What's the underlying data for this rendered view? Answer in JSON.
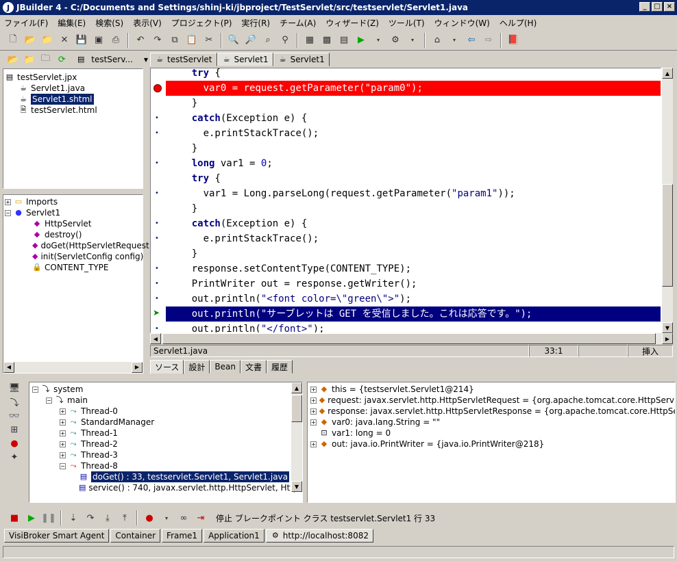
{
  "window": {
    "title": "JBuilder 4 - C:/Documents and Settings/shinj-ki/jbproject/TestServlet/src/testservlet/Servlet1.java",
    "app_icon": "J"
  },
  "menu": [
    "ファイル(F)",
    "編集(E)",
    "検索(S)",
    "表示(V)",
    "プロジェクト(P)",
    "実行(R)",
    "チーム(A)",
    "ウィザード(Z)",
    "ツール(T)",
    "ウィンドウ(W)",
    "ヘルプ(H)"
  ],
  "project_bar": {
    "combo": "testServ...",
    "tabs": [
      "testServlet",
      "Servlet1",
      "Servlet1"
    ]
  },
  "project_tree": {
    "root": "testServlet.jpx",
    "items": [
      "Servlet1.java",
      "Servlet1.shtml",
      "testServlet.html"
    ],
    "selected": 1
  },
  "structure_tree": {
    "imports": "Imports",
    "class": "Servlet1",
    "members": [
      "HttpServlet",
      "destroy()",
      "doGet(HttpServletRequest",
      "init(ServletConfig config)",
      "CONTENT_TYPE"
    ]
  },
  "editor": {
    "lines": [
      {
        "indent": "    ",
        "parts": [
          [
            "kw",
            "try"
          ],
          [
            "",
            " {"
          ]
        ],
        "mark": ""
      },
      {
        "indent": "      ",
        "parts": [
          [
            "",
            "var0 = request.getParameter("
          ],
          [
            "",
            "\"param0\""
          ],
          [
            "",
            ");"
          ]
        ],
        "mark": "breakpoint",
        "hl": "red"
      },
      {
        "indent": "    ",
        "parts": [
          [
            "",
            "}"
          ]
        ],
        "mark": ""
      },
      {
        "indent": "    ",
        "parts": [
          [
            "kw",
            "catch"
          ],
          [
            "",
            "(Exception e) {"
          ]
        ],
        "mark": "dot"
      },
      {
        "indent": "      ",
        "parts": [
          [
            "",
            "e.printStackTrace();"
          ]
        ],
        "mark": "dot"
      },
      {
        "indent": "    ",
        "parts": [
          [
            "",
            "}"
          ]
        ],
        "mark": ""
      },
      {
        "indent": "    ",
        "parts": [
          [
            "kw",
            "long"
          ],
          [
            "",
            " var1 = "
          ],
          [
            "num",
            "0"
          ],
          [
            "",
            ";"
          ]
        ],
        "mark": "dot"
      },
      {
        "indent": "    ",
        "parts": [
          [
            "kw",
            "try"
          ],
          [
            "",
            " {"
          ]
        ],
        "mark": ""
      },
      {
        "indent": "      ",
        "parts": [
          [
            "",
            "var1 = Long.parseLong(request.getParameter("
          ],
          [
            "str",
            "\"param1\""
          ],
          [
            "",
            "));"
          ]
        ],
        "mark": "dot"
      },
      {
        "indent": "    ",
        "parts": [
          [
            "",
            "}"
          ]
        ],
        "mark": ""
      },
      {
        "indent": "    ",
        "parts": [
          [
            "kw",
            "catch"
          ],
          [
            "",
            "(Exception e) {"
          ]
        ],
        "mark": "dot"
      },
      {
        "indent": "      ",
        "parts": [
          [
            "",
            "e.printStackTrace();"
          ]
        ],
        "mark": "dot"
      },
      {
        "indent": "    ",
        "parts": [
          [
            "",
            "}"
          ]
        ],
        "mark": ""
      },
      {
        "indent": "    ",
        "parts": [
          [
            "",
            "response.setContentType(CONTENT_TYPE);"
          ]
        ],
        "mark": "dot"
      },
      {
        "indent": "    ",
        "parts": [
          [
            "",
            "PrintWriter out = response.getWriter();"
          ]
        ],
        "mark": "dot"
      },
      {
        "indent": "    ",
        "parts": [
          [
            "",
            "out.println("
          ],
          [
            "str",
            "\"<font color=\\\"green\\\">\""
          ],
          [
            "",
            ");"
          ]
        ],
        "mark": "dot"
      },
      {
        "indent": "    ",
        "parts": [
          [
            "",
            "out.println(\"サーブレットは GET を受信しました。これは応答です。\");"
          ]
        ],
        "mark": "exec",
        "hl": "blue"
      },
      {
        "indent": "    ",
        "parts": [
          [
            "",
            "out.println("
          ],
          [
            "str",
            "\"</font>\""
          ],
          [
            "",
            ");"
          ]
        ],
        "mark": "dot"
      }
    ]
  },
  "editor_status": {
    "file": "Servlet1.java",
    "pos": "33:1",
    "mode": "挿入"
  },
  "editor_tabs": [
    "ソース",
    "設計",
    "Bean",
    "文書",
    "履歴"
  ],
  "threads": {
    "root": "system",
    "group": "main",
    "items": [
      "Thread-0",
      "StandardManager",
      "Thread-1",
      "Thread-2",
      "Thread-3",
      "Thread-8"
    ],
    "frames": [
      "doGet() : 33, testservlet.Servlet1, Servlet1.java",
      "service() : 740, javax.servlet.http.HttpServlet, HttpSer"
    ]
  },
  "variables": [
    "this = {testservlet.Servlet1@214}",
    "request: javax.servlet.http.HttpServletRequest = {org.apache.tomcat.core.HttpServletRequ",
    "response: javax.servlet.http.HttpServletResponse = {org.apache.tomcat.core.HttpServletR",
    "var0: java.lang.String = \"\"",
    "var1: long = 0",
    "out: java.io.PrintWriter = {java.io.PrintWriter@218}"
  ],
  "debug_status": "停止 ブレークポイント クラス testservlet.Servlet1 行 33",
  "bottom_tabs": [
    "VisiBroker Smart Agent",
    "Container",
    "Frame1",
    "Application1",
    "http://localhost:8082"
  ],
  "colors": {
    "titlebar": "#0a246a",
    "breakpoint_line": "#ff0000",
    "exec_line": "#000080",
    "keyword": "#000080"
  }
}
